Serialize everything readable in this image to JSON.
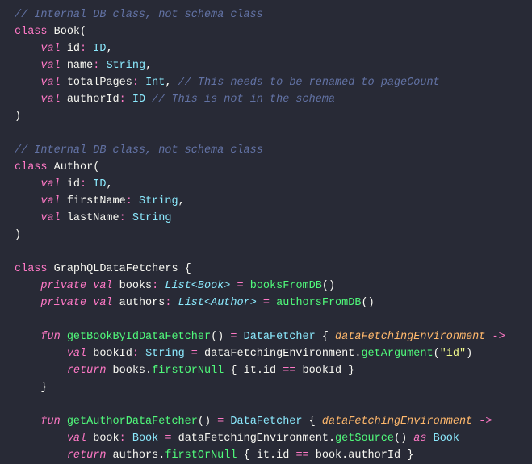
{
  "lines": {
    "c1": "// Internal DB class, not schema class",
    "kw_class": "class",
    "book": "Book",
    "kw_val": "val",
    "id": "id",
    "type_ID": "ID",
    "name_fld": "name",
    "type_String": "String",
    "totalPages": "totalPages",
    "type_Int": "Int",
    "c2": "// This needs to be renamed to pageCount",
    "authorId_fld": "authorId",
    "c3": "// This is not in the schema",
    "author": "Author",
    "firstName": "firstName",
    "lastName": "lastName",
    "gql": "GraphQLDataFetchers",
    "kw_private": "private",
    "books": "books",
    "type_List_Book": "List<Book>",
    "booksFromDB": "booksFromDB",
    "authors": "authors",
    "type_List_Author": "List<Author>",
    "authorsFromDB": "authorsFromDB",
    "kw_fun": "fun",
    "getBookById": "getBookByIdDataFetcher",
    "DataFetcher": "DataFetcher",
    "dfe": "dataFetchingEnvironment",
    "arrow": "->",
    "bookId": "bookId",
    "getArgument": "getArgument",
    "str_id": "\"id\"",
    "kw_return": "return",
    "firstOrNull": "firstOrNull",
    "it": "it",
    "dot_id": ".id",
    "eqeq": "==",
    "getAuthor": "getAuthorDataFetcher",
    "book_var": "book",
    "getSource": "getSource",
    "kw_as": "as",
    "Book_type": "Book",
    "dot_authorId": ".authorId"
  }
}
